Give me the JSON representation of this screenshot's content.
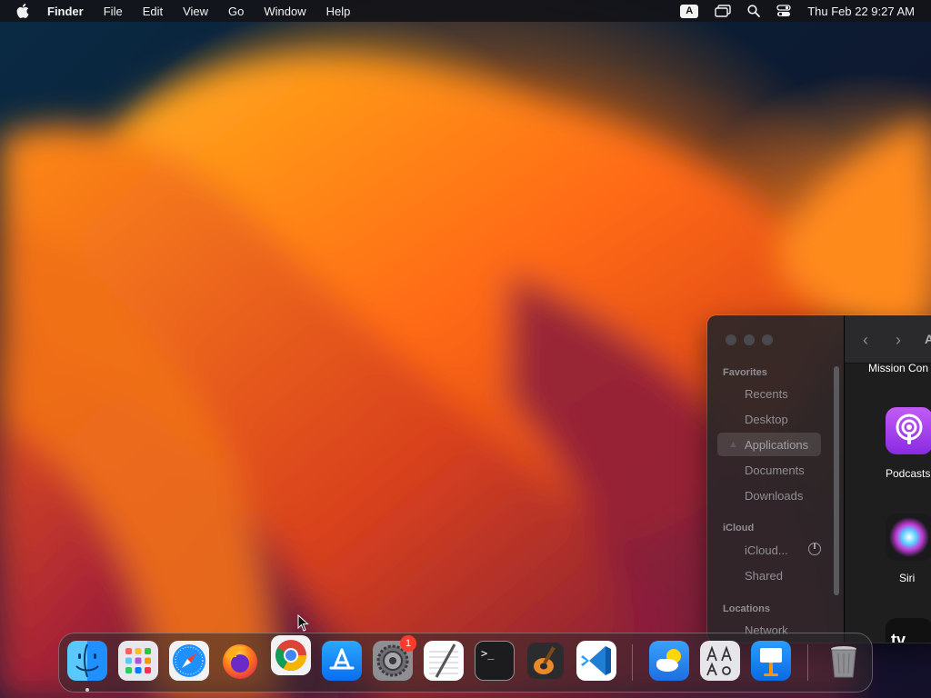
{
  "menubar": {
    "app_name": "Finder",
    "menus": [
      "File",
      "Edit",
      "View",
      "Go",
      "Window",
      "Help"
    ],
    "input_source": "A",
    "clock": "Thu Feb 22  9:27 AM"
  },
  "finder": {
    "sidebar": {
      "favorites_heading": "Favorites",
      "favorites": [
        "Recents",
        "Desktop",
        "Applications",
        "Documents",
        "Downloads"
      ],
      "selected": "Applications",
      "icloud_heading": "iCloud",
      "icloud": [
        "iCloud...",
        "Shared"
      ],
      "locations_heading": "Locations",
      "locations": [
        "Network"
      ]
    },
    "path_title": "A",
    "grid_items": [
      "Mission Con",
      "Podcasts",
      "Siri",
      "TV"
    ]
  },
  "dock": {
    "apps": [
      {
        "name": "finder-icon",
        "running": true
      },
      {
        "name": "launchpad-icon"
      },
      {
        "name": "safari-icon"
      },
      {
        "name": "firefox-icon"
      },
      {
        "name": "chrome-icon"
      },
      {
        "name": "app-store-icon"
      },
      {
        "name": "system-settings-icon",
        "badge": "1"
      },
      {
        "name": "textedit-icon"
      },
      {
        "name": "terminal-icon"
      },
      {
        "name": "garageband-icon"
      },
      {
        "name": "vscode-icon"
      },
      {
        "name": "weather-icon"
      },
      {
        "name": "font-book-icon"
      },
      {
        "name": "keynote-icon"
      },
      {
        "name": "trash-icon"
      }
    ],
    "settings_badge": "1",
    "terminal_prompt": ">_",
    "tv_glyph": "tv"
  },
  "colors": {
    "menubar_bg": "#141418",
    "badge_red": "#ff3b30",
    "vscode_blue": "#1f7fd4"
  }
}
